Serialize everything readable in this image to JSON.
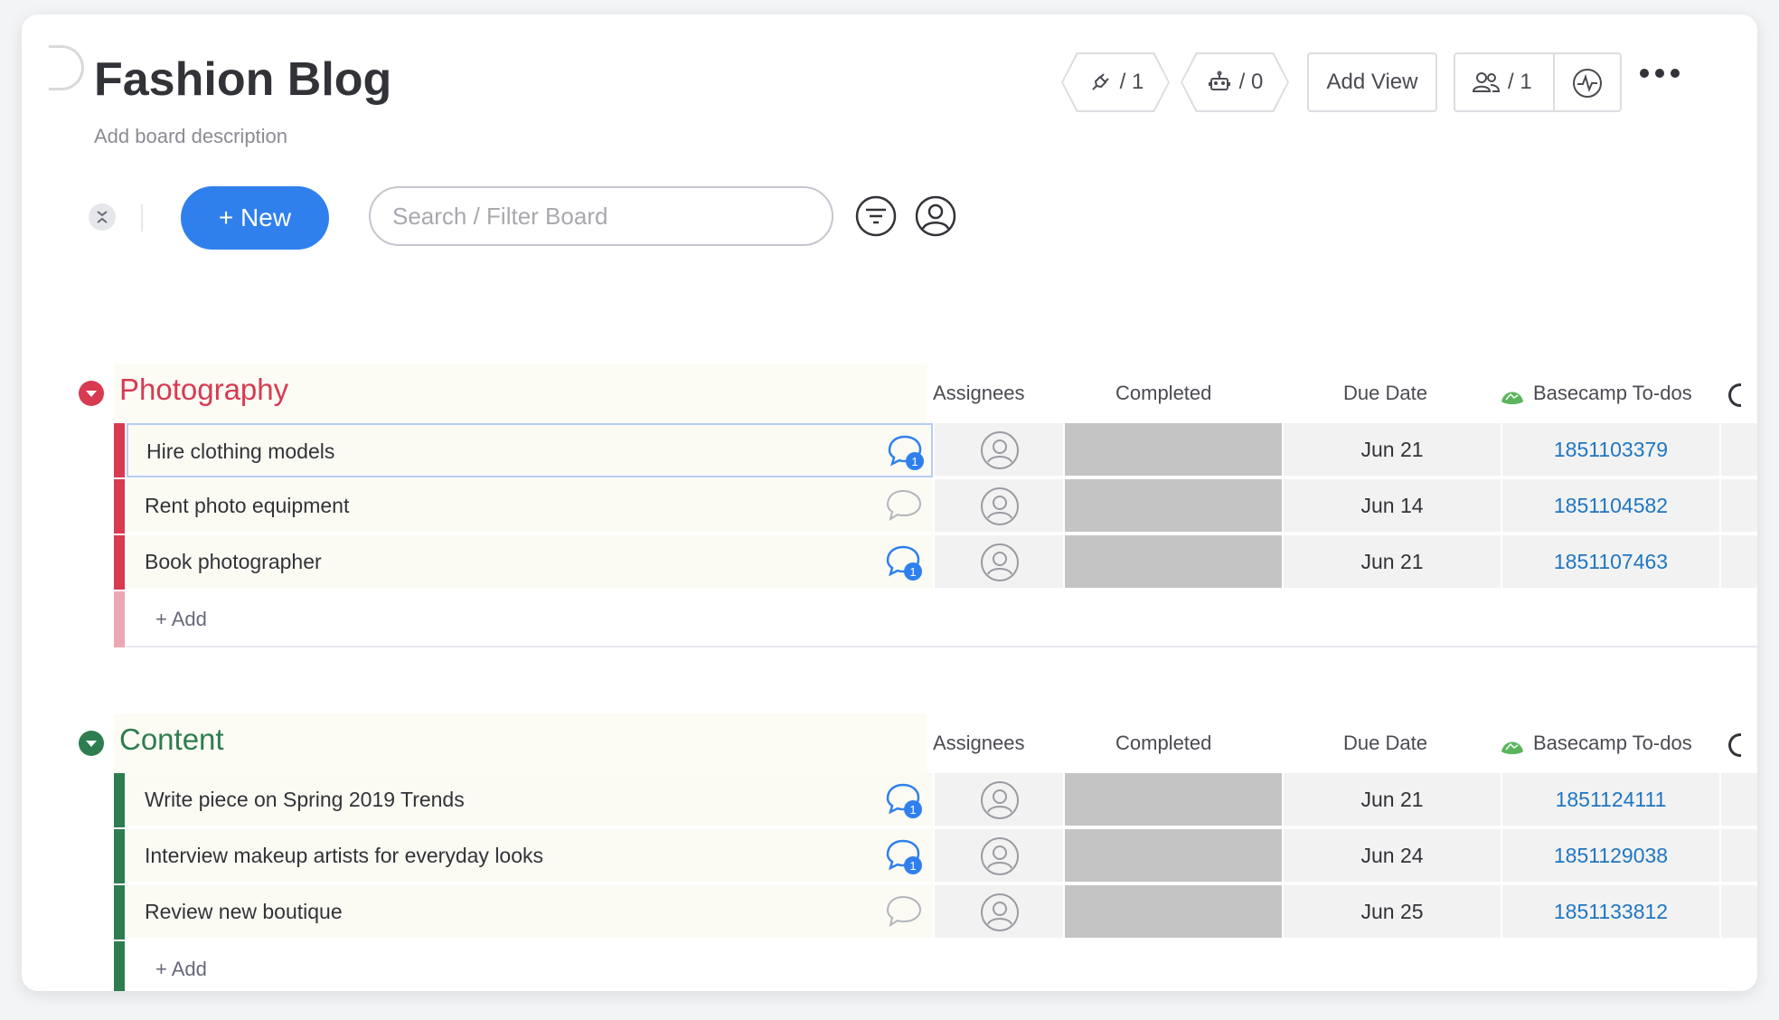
{
  "board": {
    "title": "Fashion Blog",
    "description": "Add board description"
  },
  "header": {
    "integrations_count": "/ 1",
    "automations_count": "/ 0",
    "add_view_label": "Add View",
    "members_count": "/ 1",
    "icons": [
      "plug-icon",
      "robot-icon",
      "people-icon",
      "activity-icon",
      "more-icon"
    ]
  },
  "toolbar": {
    "new_label": "+ New",
    "search_placeholder": "Search / Filter Board",
    "icons": [
      "collapse-icon",
      "filter-icon",
      "person-filter-icon"
    ]
  },
  "columns": {
    "assignees": "Assignees",
    "completed": "Completed",
    "due_date": "Due Date",
    "basecamp": "Basecamp To-dos"
  },
  "colors": {
    "photography": "#d83a52",
    "content": "#2e7d4f",
    "primary": "#2f80ed",
    "link": "#1f76c2",
    "completed_cell": "#c4c4c4"
  },
  "groups": [
    {
      "title": "Photography",
      "add_label": "+ Add",
      "items": [
        {
          "name": "Hire clothing models",
          "updates": "1",
          "due": "Jun 21",
          "basecamp": "1851103379"
        },
        {
          "name": "Rent photo equipment",
          "updates": "",
          "due": "Jun 14",
          "basecamp": "1851104582"
        },
        {
          "name": "Book photographer",
          "updates": "1",
          "due": "Jun 21",
          "basecamp": "1851107463"
        }
      ]
    },
    {
      "title": "Content",
      "add_label": "+ Add",
      "items": [
        {
          "name": "Write piece on Spring 2019 Trends",
          "updates": "1",
          "due": "Jun 21",
          "basecamp": "1851124111"
        },
        {
          "name": "Interview makeup artists for everyday looks",
          "updates": "1",
          "due": "Jun 24",
          "basecamp": "1851129038"
        },
        {
          "name": "Review new boutique",
          "updates": "",
          "due": "Jun 25",
          "basecamp": "1851133812"
        }
      ]
    }
  ]
}
